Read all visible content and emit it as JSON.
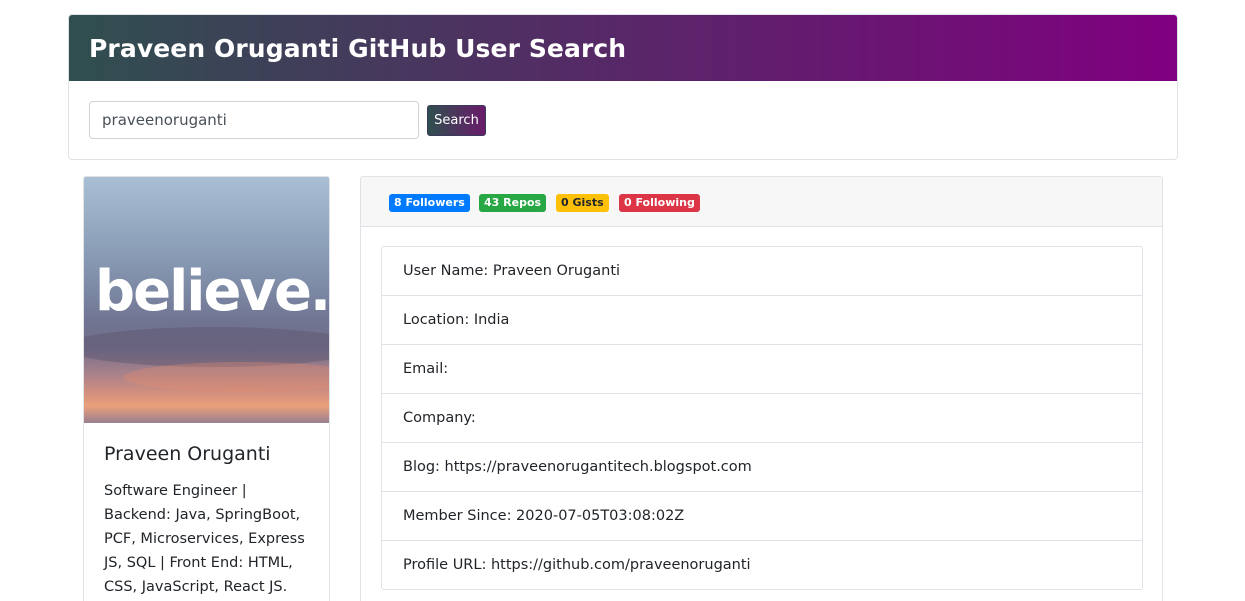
{
  "header": {
    "title": "Praveen Oruganti GitHub User Search"
  },
  "search": {
    "value": "praveenoruganti",
    "button_label": "Search"
  },
  "profile": {
    "avatar_text": "believe.",
    "name": "Praveen Oruganti",
    "bio": "Software Engineer | Backend: Java, SpringBoot, PCF, Microservices, Express JS, SQL | Front End: HTML, CSS, JavaScript, React JS."
  },
  "badges": {
    "followers": "8 Followers",
    "repos": "43 Repos",
    "gists": "0 Gists",
    "following": "0 Following"
  },
  "details": [
    "User Name: Praveen Oruganti",
    "Location: India",
    "Email:",
    "Company:",
    "Blog: https://praveenorugantitech.blogspot.com",
    "Member Since: 2020-07-05T03:08:02Z",
    "Profile URL: https://github.com/praveenoruganti"
  ],
  "colors": {
    "header_gradient_start": "#2f4f4f",
    "header_gradient_end": "#800080",
    "followers_badge": "#007bff",
    "repos_badge": "#28a745",
    "gists_badge": "#ffc107",
    "following_badge": "#dc3545"
  }
}
